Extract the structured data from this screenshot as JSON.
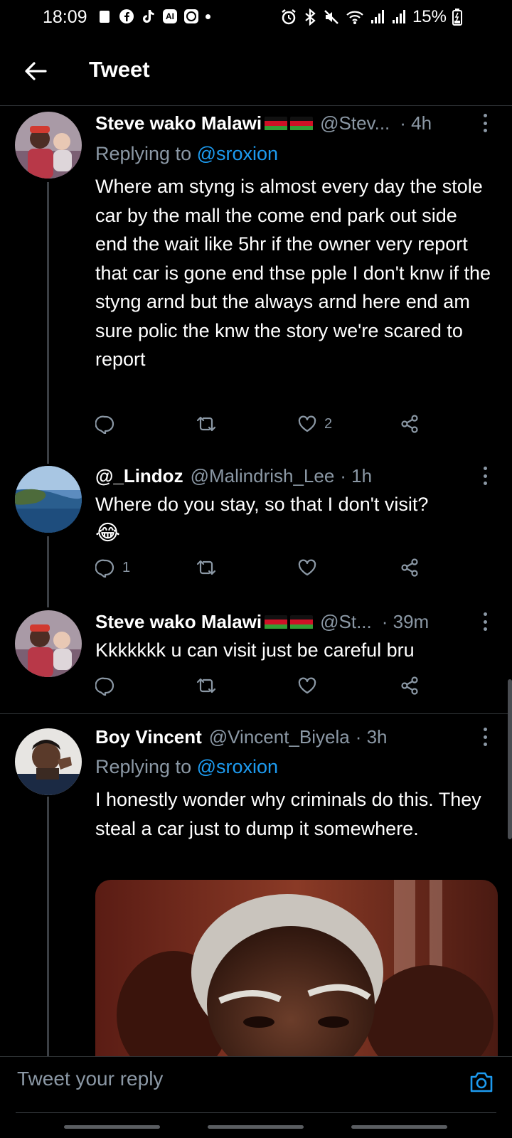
{
  "status_bar": {
    "time": "18:09",
    "ai_label": "AI",
    "battery": "15%"
  },
  "header": {
    "title": "Tweet"
  },
  "tweets": [
    {
      "name": "Steve wako Malawi",
      "handle": "@Stev...",
      "time": "· 4h",
      "replying_prefix": "Replying to ",
      "replying_to": "@sroxion",
      "text": "Where am styng is almost every day the stole car by the mall the come end park out side end the wait like 5hr if the owner very report that car is gone end thse pple I don't knw if the styng arnd but the always arnd here end am sure polic the knw the story we're scared to report",
      "reply_count": "",
      "like_count": "2"
    },
    {
      "name": "@_Lindoz",
      "handle": "@Malindrish_Lee",
      "time": "· 1h",
      "text": "Where do you stay, so that I don't visit?",
      "emoji": "😂",
      "reply_count": "1",
      "like_count": ""
    },
    {
      "name": "Steve wako Malawi",
      "handle": "@St...",
      "time": "· 39m",
      "text": "Kkkkkkk u can visit just be careful bru",
      "reply_count": "",
      "like_count": ""
    },
    {
      "name": "Boy Vincent",
      "handle": "@Vincent_Biyela",
      "time": "· 3h",
      "replying_prefix": "Replying to ",
      "replying_to": "@sroxion",
      "text": "I honestly wonder why criminals do this. They steal a car just to dump it somewhere."
    }
  ],
  "reply_bar": {
    "placeholder": "Tweet your reply"
  },
  "colors": {
    "background": "#000000",
    "accent": "#1d9bf0",
    "secondary_text": "#8b98a5",
    "divider": "#2f3336"
  },
  "icons": [
    "back-arrow-icon",
    "reply-icon",
    "retweet-icon",
    "like-icon",
    "share-icon",
    "more-icon",
    "camera-icon"
  ]
}
